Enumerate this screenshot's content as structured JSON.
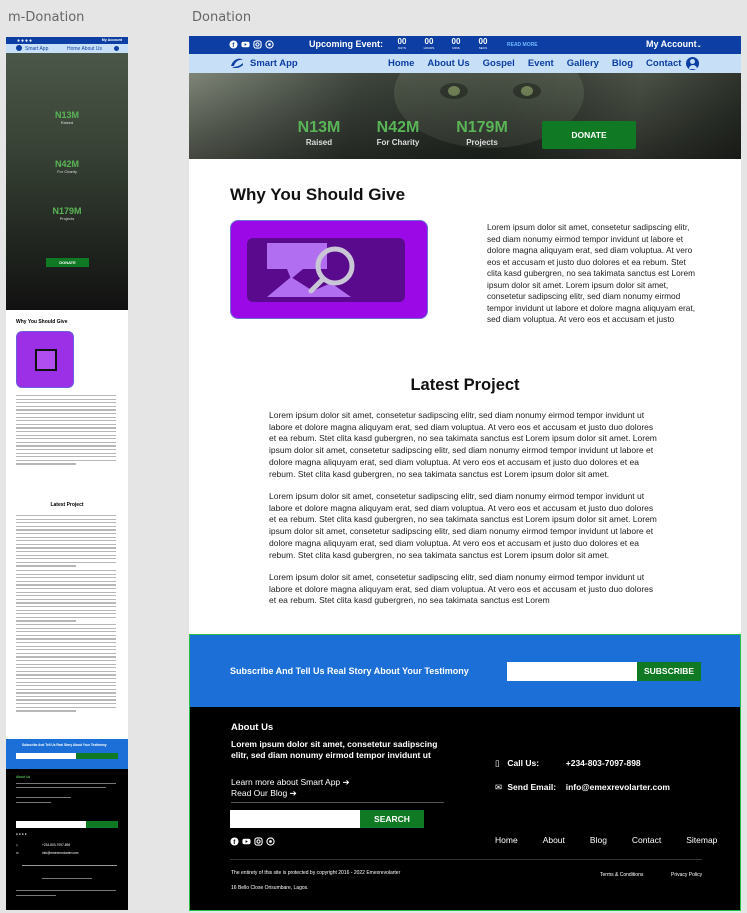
{
  "frames": {
    "mobile_label": "m-Donation",
    "desktop_label": "Donation"
  },
  "topbar": {
    "upcoming_label": "Upcoming Event:",
    "countdown": [
      {
        "value": "00",
        "unit": "DAYS"
      },
      {
        "value": "00",
        "unit": "HOURS"
      },
      {
        "value": "00",
        "unit": "MINS"
      },
      {
        "value": "00",
        "unit": "SECS"
      }
    ],
    "read_more": "READ MORE",
    "account": "My Account"
  },
  "nav": {
    "brand": "Smart App",
    "links": [
      "Home",
      "About Us",
      "Gospel",
      "Event",
      "Gallery",
      "Blog",
      "Contact"
    ]
  },
  "hero": {
    "stats": [
      {
        "value": "N13M",
        "label": "Raised"
      },
      {
        "value": "N42M",
        "label": "For Charity"
      },
      {
        "value": "N179M",
        "label": "Projects"
      }
    ],
    "donate_label": "DONATE"
  },
  "why": {
    "title": "Why You Should Give",
    "text": "Lorem ipsum dolor sit amet, consetetur sadipscing elitr, sed diam nonumy eirmod tempor invidunt ut labore et dolore magna aliquyam erat, sed diam voluptua. At vero eos et accusam et justo duo dolores et ea rebum. Stet clita kasd gubergren, no sea takimata sanctus est Lorem ipsum dolor sit amet. Lorem ipsum dolor sit amet, consetetur sadipscing elitr, sed diam nonumy eirmod tempor invidunt ut labore et dolore magna aliquyam erat, sed diam voluptua. At vero eos et accusam et justo"
  },
  "latest": {
    "title": "Latest Project",
    "paragraphs": [
      "Lorem ipsum dolor sit amet, consetetur sadipscing elitr, sed diam nonumy eirmod tempor invidunt ut labore et dolore magna aliquyam erat, sed diam voluptua. At vero eos et accusam et justo duo dolores et ea rebum. Stet clita kasd gubergren, no sea takimata sanctus est Lorem ipsum dolor sit amet. Lorem ipsum dolor sit amet, consetetur sadipscing elitr, sed diam nonumy eirmod tempor invidunt ut labore et dolore magna aliquyam erat, sed diam voluptua. At vero eos et accusam et justo duo dolores et ea rebum. Stet clita kasd gubergren, no sea takimata sanctus est Lorem ipsum dolor sit amet.",
      "Lorem ipsum dolor sit amet, consetetur sadipscing elitr, sed diam nonumy eirmod tempor invidunt ut labore et dolore magna aliquyam erat, sed diam voluptua. At vero eos et accusam et justo duo dolores et ea rebum. Stet clita kasd gubergren, no sea takimata sanctus est Lorem ipsum dolor sit amet. Lorem ipsum dolor sit amet, consetetur sadipscing elitr, sed diam nonumy eirmod tempor invidunt ut labore et dolore magna aliquyam erat, sed diam voluptua. At vero eos et accusam et justo duo dolores et ea rebum. Stet clita kasd gubergren, no sea takimata sanctus est Lorem ipsum dolor sit amet.",
      "Lorem ipsum dolor sit amet, consetetur sadipscing elitr, sed diam nonumy eirmod tempor invidunt ut labore et dolore magna aliquyam erat, sed diam voluptua. At vero eos et accusam et justo duo dolores et ea rebum. Stet clita kasd gubergren, no sea takimata sanctus est Lorem"
    ]
  },
  "subscribe": {
    "text": "Subscribe And Tell Us Real Story About Your Testimony",
    "button": "SUBSCRIBE"
  },
  "footer": {
    "about_heading": "About Us",
    "about_text": "Lorem ipsum dolor sit amet, consetetur sadipscing elitr, sed diam nonumy eirmod tempor invidunt ut",
    "learn_more": "Learn more about Smart App ➔",
    "read_blog": "Read Our Blog ➔",
    "search_button": "SEARCH",
    "call_label": "Call Us:",
    "phone": "+234-803-7097-898",
    "email_label": "Send Email:",
    "email": "info@emexrevolarter.com",
    "nav": [
      "Home",
      "About",
      "Blog",
      "Contact",
      "Sitemap"
    ],
    "copyright": "The entirety of this site is protected by copyright  2016 - 2022 Emexrevolarter",
    "address": "16 Bello Close Orisumbare, Lagos.",
    "terms": "Terms & Conditions",
    "privacy": "Privacy Policy"
  },
  "mobile": {
    "account": "My Account",
    "brand": "Smart App",
    "links": "Home  About Us",
    "donate": "DONATE",
    "why_title": "Why You Should Give",
    "latest_title": "Latest Project",
    "sub_text": "Subscribe And Tell Us Real Story About Your Testimony",
    "about_heading": "About Us",
    "phone": "+234-803-7097-898",
    "email": "info@emexrevolarter.com"
  },
  "colors": {
    "topbar": "#0c3ea3",
    "nav_bg": "#c8dff8",
    "accent_green": "#0f7a23",
    "stat_green": "#5ab557",
    "subscribe_blue": "#1b6fd6",
    "image_purple": "#9b0ae6"
  }
}
